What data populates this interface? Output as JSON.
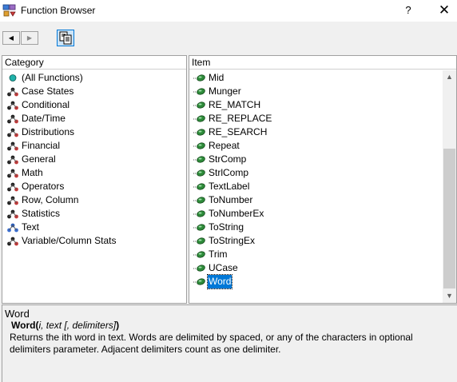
{
  "window": {
    "title": "Function Browser",
    "help_label": "?",
    "close_label": "✕"
  },
  "toolbar": {
    "back_glyph": "◀",
    "forward_glyph": "▶",
    "copy_icon": "copy-to-clipboard-icon"
  },
  "category_pane": {
    "header": "Category",
    "items": [
      {
        "label": "(All Functions)",
        "icon": "globe-icon"
      },
      {
        "label": "Case States",
        "icon": "category-icon"
      },
      {
        "label": "Conditional",
        "icon": "category-icon"
      },
      {
        "label": "Date/Time",
        "icon": "category-icon"
      },
      {
        "label": "Distributions",
        "icon": "category-icon"
      },
      {
        "label": "Financial",
        "icon": "category-icon"
      },
      {
        "label": "General",
        "icon": "category-icon"
      },
      {
        "label": "Math",
        "icon": "category-icon"
      },
      {
        "label": "Operators",
        "icon": "category-icon"
      },
      {
        "label": "Row, Column",
        "icon": "category-icon"
      },
      {
        "label": "Statistics",
        "icon": "category-icon"
      },
      {
        "label": "Text",
        "icon": "category-icon-selected"
      },
      {
        "label": "Variable/Column Stats",
        "icon": "category-icon"
      }
    ]
  },
  "item_pane": {
    "header": "Item",
    "items": [
      {
        "label": "Mid"
      },
      {
        "label": "Munger"
      },
      {
        "label": "RE_MATCH"
      },
      {
        "label": "RE_REPLACE"
      },
      {
        "label": "RE_SEARCH"
      },
      {
        "label": "Repeat"
      },
      {
        "label": "StrComp"
      },
      {
        "label": "StrlComp"
      },
      {
        "label": "TextLabel"
      },
      {
        "label": "ToNumber"
      },
      {
        "label": "ToNumberEx"
      },
      {
        "label": "ToString"
      },
      {
        "label": "ToStringEx"
      },
      {
        "label": "Trim"
      },
      {
        "label": "UCase"
      },
      {
        "label": "Word",
        "selected": true
      }
    ],
    "scroll_up_glyph": "▲",
    "scroll_down_glyph": "▼"
  },
  "description": {
    "title": "Word",
    "fn_name": "Word",
    "open_paren": "(",
    "args": "i, text [, delimiters]",
    "close_paren": ")",
    "text": "Returns the ith word in text. Words are delimited by spaced, or any of the characters in optional delimiters parameter. Adjacent delimiters count as one delimiter."
  },
  "colors": {
    "selection": "#0078d7",
    "globe": "#20b2aa",
    "item_icon": "#2e8b3a"
  }
}
